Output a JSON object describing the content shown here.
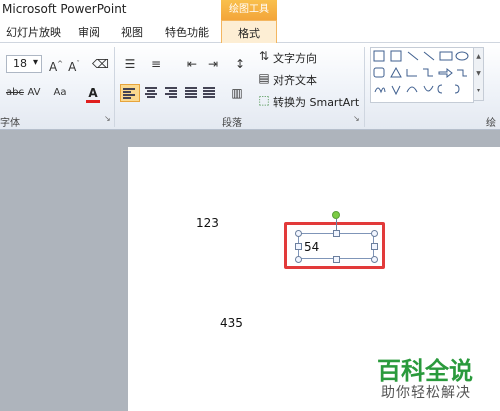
{
  "window": {
    "title": "Microsoft PowerPoint",
    "context_group": "绘图工具"
  },
  "tabs": [
    "幻灯片放映",
    "审阅",
    "视图",
    "特色功能"
  ],
  "active_tab": "格式",
  "ribbon": {
    "font": {
      "size": "18",
      "group_label": "字体"
    },
    "paragraph": {
      "group_label": "段落",
      "text_direction": "文字方向",
      "align_text": "对齐文本",
      "convert_smartart": "转换为 SmartArt"
    },
    "drawing": {
      "group_label": "绘"
    }
  },
  "slide": {
    "text_1": "123",
    "text_2": "54",
    "text_3": "435"
  },
  "watermark": {
    "line1": "百科全说",
    "line2": "助你轻松解决"
  },
  "colors": {
    "highlight": "#e23a3a",
    "context_tab": "#f3a53a",
    "watermark": "#2a9a3c"
  }
}
